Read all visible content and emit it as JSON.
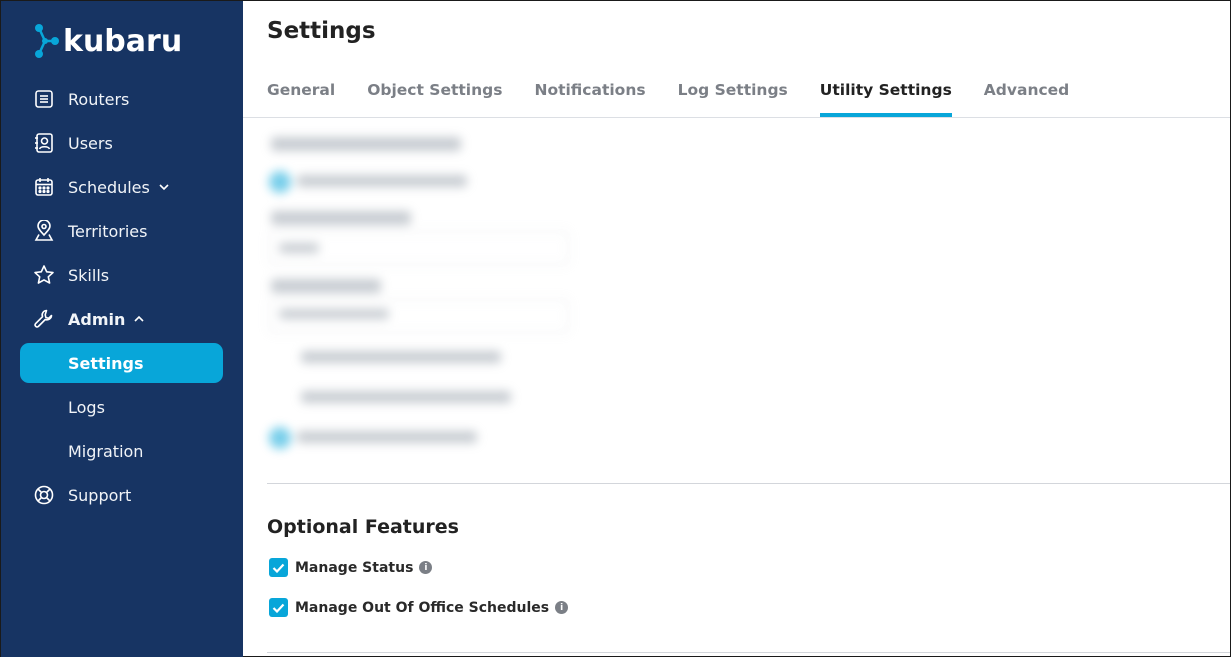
{
  "brand": {
    "name": "kubaru",
    "accent": "#08a6d9",
    "sidebar_bg": "#173463"
  },
  "sidebar": {
    "items": [
      {
        "label": "Routers",
        "icon": "list-icon"
      },
      {
        "label": "Users",
        "icon": "contact-book-icon"
      },
      {
        "label": "Schedules",
        "icon": "calendar-icon"
      },
      {
        "label": "Territories",
        "icon": "map-pin-icon"
      },
      {
        "label": "Skills",
        "icon": "star-icon"
      },
      {
        "label": "Admin",
        "icon": "wrench-icon"
      },
      {
        "label": "Support",
        "icon": "lifebuoy-icon"
      }
    ],
    "admin_sub": [
      {
        "label": "Settings"
      },
      {
        "label": "Logs"
      },
      {
        "label": "Migration"
      }
    ]
  },
  "page": {
    "title": "Settings"
  },
  "tabs": [
    {
      "label": "General"
    },
    {
      "label": "Object Settings"
    },
    {
      "label": "Notifications"
    },
    {
      "label": "Log Settings"
    },
    {
      "label": "Utility Settings"
    },
    {
      "label": "Advanced"
    }
  ],
  "active_tab": "Utility Settings",
  "optional_features": {
    "title": "Optional Features",
    "options": [
      {
        "label": "Manage Status",
        "checked": true
      },
      {
        "label": "Manage Out Of Office Schedules",
        "checked": true
      }
    ]
  }
}
